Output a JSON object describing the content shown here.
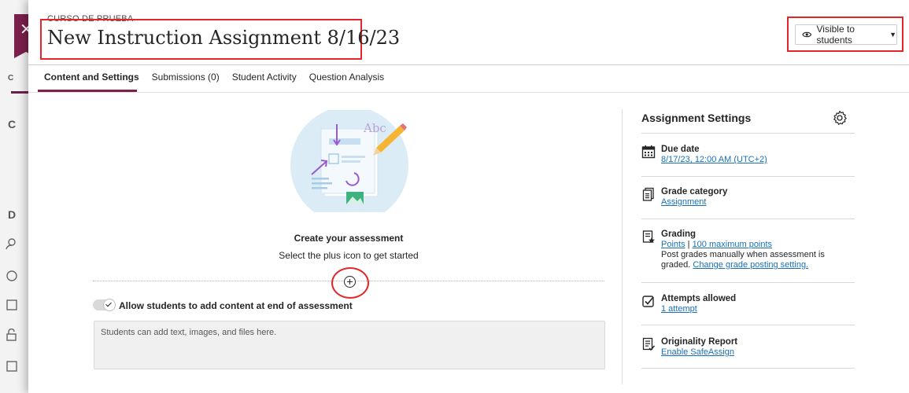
{
  "header": {
    "course_label": "CURSO DE PRUEBA",
    "title": "New Instruction Assignment 8/16/23",
    "visibility_label": "Visible to students"
  },
  "tabs": [
    {
      "label": "Content and Settings"
    },
    {
      "label": "Submissions (0)"
    },
    {
      "label": "Student Activity"
    },
    {
      "label": "Question Analysis"
    }
  ],
  "main": {
    "illustration_text": "Abc",
    "create_title": "Create your assessment",
    "create_subtitle": "Select the plus icon to get started",
    "toggle_label": "Allow students to add content at end of assessment",
    "toggle_on": true,
    "textarea_placeholder": "Students can add text, images, and files here."
  },
  "settings": {
    "title": "Assignment Settings",
    "due_date": {
      "label": "Due date",
      "value": "8/17/23, 12:00 AM (UTC+2)"
    },
    "grade_category": {
      "label": "Grade category",
      "value": "Assignment"
    },
    "grading": {
      "label": "Grading",
      "points_link": "Points",
      "separator": "|",
      "max_link": "100 maximum points",
      "note": "Post grades manually when assessment is",
      "note2": "graded.",
      "change_link": "Change grade posting setting."
    },
    "attempts": {
      "label": "Attempts allowed",
      "value": "1 attempt"
    },
    "originality": {
      "label": "Originality Report",
      "value": "Enable SafeAssign"
    }
  },
  "background": {
    "letters": [
      "C",
      "C",
      "D"
    ]
  },
  "colors": {
    "accent": "#7b1f4d",
    "highlight": "#e4262a",
    "link": "#1a70b8"
  }
}
